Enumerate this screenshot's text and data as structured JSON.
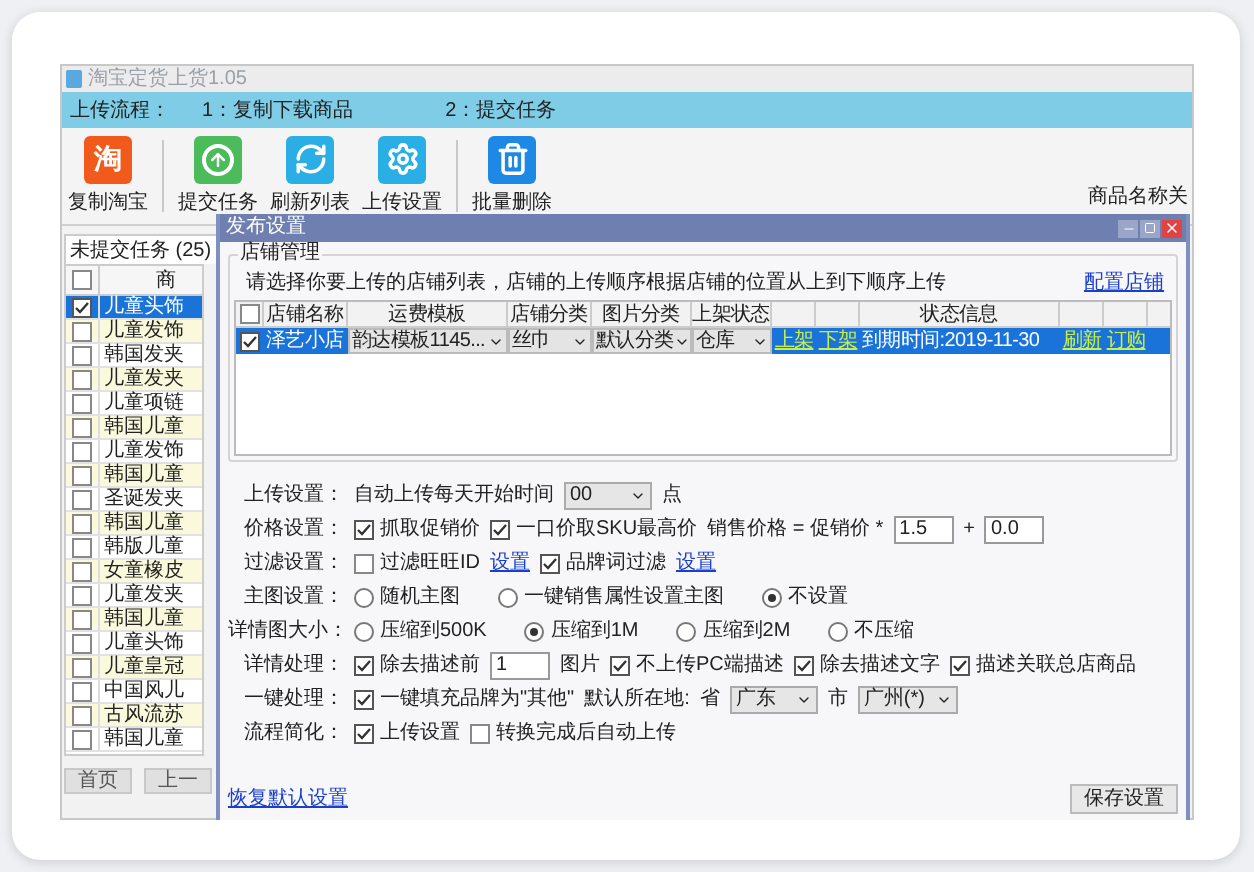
{
  "window": {
    "title": "淘宝定货上货1.05"
  },
  "flow_bar": {
    "label": "上传流程：",
    "steps": [
      "1：复制下载商品",
      "2：提交任务"
    ]
  },
  "toolbar": [
    {
      "kind": "taobao",
      "glyph": "淘",
      "label": "复制淘宝"
    },
    {
      "kind": "upload",
      "label": "提交任务"
    },
    {
      "kind": "refresh",
      "label": "刷新列表"
    },
    {
      "kind": "settings",
      "label": "上传设置"
    },
    {
      "kind": "delete",
      "label": "批量删除"
    }
  ],
  "search_label": "商品名称关",
  "tabs": [
    {
      "label": "未提交任务 (25)",
      "selected": true
    }
  ],
  "task_table": {
    "header_checked": false,
    "columns": [
      "商"
    ],
    "rows": [
      {
        "name": "儿童头饰",
        "checked": true,
        "selected": true
      },
      {
        "name": "儿童发饰",
        "checked": false,
        "selected": false
      },
      {
        "name": "韩国发夹",
        "checked": false,
        "selected": false
      },
      {
        "name": "儿童发夹",
        "checked": false,
        "selected": false
      },
      {
        "name": "儿童项链",
        "checked": false,
        "selected": false
      },
      {
        "name": "韩国儿童",
        "checked": false,
        "selected": false
      },
      {
        "name": "儿童发饰",
        "checked": false,
        "selected": false
      },
      {
        "name": "韩国儿童",
        "checked": false,
        "selected": false
      },
      {
        "name": "圣诞发夹",
        "checked": false,
        "selected": false
      },
      {
        "name": "韩国儿童",
        "checked": false,
        "selected": false
      },
      {
        "name": "韩版儿童",
        "checked": false,
        "selected": false
      },
      {
        "name": "女童橡皮",
        "checked": false,
        "selected": false
      },
      {
        "name": "儿童发夹",
        "checked": false,
        "selected": false
      },
      {
        "name": "韩国儿童",
        "checked": false,
        "selected": false
      },
      {
        "name": "儿童头饰",
        "checked": false,
        "selected": false
      },
      {
        "name": "儿童皇冠",
        "checked": false,
        "selected": false
      },
      {
        "name": "中国风儿",
        "checked": false,
        "selected": false
      },
      {
        "name": "古风流苏",
        "checked": false,
        "selected": false
      },
      {
        "name": "韩国儿童",
        "checked": false,
        "selected": false
      }
    ]
  },
  "pager": [
    "首页",
    "上一"
  ],
  "dialog": {
    "title": "发布设置",
    "shop_group": {
      "title": "店铺管理",
      "hint": "请选择你要上传的店铺列表，店铺的上传顺序根据店铺的位置从上到下顺序上传",
      "config_link": "配置店铺",
      "columns": [
        {
          "kind": "check",
          "checked": false
        },
        {
          "kind": "text",
          "label": "店铺名称"
        },
        {
          "kind": "text",
          "label": "运费模板"
        },
        {
          "kind": "text",
          "label": "店铺分类"
        },
        {
          "kind": "text",
          "label": "图片分类"
        },
        {
          "kind": "text",
          "label": "上架状态"
        },
        {
          "kind": "blank"
        },
        {
          "kind": "blank"
        },
        {
          "kind": "text",
          "label": "状态信息"
        },
        {
          "kind": "blank"
        },
        {
          "kind": "blank"
        }
      ],
      "rows": [
        {
          "selected": true,
          "cells": [
            {
              "kind": "check",
              "checked": true
            },
            {
              "kind": "text",
              "text": "泽艺小店"
            },
            {
              "kind": "select",
              "text": "韵达模板1145..."
            },
            {
              "kind": "select",
              "text": "丝巾"
            },
            {
              "kind": "select",
              "text": "默认分类"
            },
            {
              "kind": "select",
              "text": "仓库"
            },
            {
              "kind": "link",
              "text": "上架"
            },
            {
              "kind": "link",
              "text": "下架"
            },
            {
              "kind": "text",
              "text": "到期时间:2019-11-30"
            },
            {
              "kind": "link",
              "text": "刷新"
            },
            {
              "kind": "link",
              "text": "订购"
            }
          ]
        }
      ]
    },
    "settings": [
      {
        "label": "上传设置：",
        "items": [
          {
            "kind": "text",
            "text": "自动上传每天开始时间"
          },
          {
            "kind": "select",
            "value": "00"
          },
          {
            "kind": "text",
            "text": "点"
          }
        ]
      },
      {
        "label": "价格设置：",
        "items": [
          {
            "kind": "check",
            "label": "抓取促销价",
            "checked": true
          },
          {
            "kind": "check",
            "label": "一口价取SKU最高价",
            "checked": true
          },
          {
            "kind": "text",
            "text": "销售价格 = 促销价 *"
          },
          {
            "kind": "input",
            "value": "1.5"
          },
          {
            "kind": "text",
            "text": "+"
          },
          {
            "kind": "input",
            "value": "0.0"
          }
        ]
      },
      {
        "label": "过滤设置：",
        "items": [
          {
            "kind": "check",
            "label": "过滤旺旺ID",
            "checked": false
          },
          {
            "kind": "link",
            "label": "设置"
          },
          {
            "kind": "check",
            "label": "品牌词过滤",
            "checked": true
          },
          {
            "kind": "link",
            "label": "设置"
          }
        ]
      },
      {
        "label": "主图设置：",
        "items": [
          {
            "kind": "radio",
            "label": "随机主图",
            "selected": false
          },
          {
            "kind": "radio",
            "label": "一键销售属性设置主图",
            "selected": false
          },
          {
            "kind": "radio",
            "label": "不设置",
            "selected": true
          }
        ]
      },
      {
        "label": "详情图大小：",
        "items": [
          {
            "kind": "radio",
            "label": "压缩到500K",
            "selected": false
          },
          {
            "kind": "radio",
            "label": "压缩到1M",
            "selected": true
          },
          {
            "kind": "radio",
            "label": "压缩到2M",
            "selected": false
          },
          {
            "kind": "radio",
            "label": "不压缩",
            "selected": false
          }
        ]
      },
      {
        "label": "详情处理：",
        "items": [
          {
            "kind": "check",
            "label": "除去描述前",
            "checked": true
          },
          {
            "kind": "input",
            "value": "1"
          },
          {
            "kind": "text",
            "text": "图片"
          },
          {
            "kind": "check",
            "label": "不上传PC端描述",
            "checked": true
          },
          {
            "kind": "check",
            "label": "除去描述文字",
            "checked": true
          },
          {
            "kind": "check",
            "label": "描述关联总店商品",
            "checked": true
          }
        ]
      },
      {
        "label": "一键处理：",
        "items": [
          {
            "kind": "check",
            "label": "一键填充品牌为\"其他\"",
            "checked": true
          },
          {
            "kind": "text",
            "text": "默认所在地:"
          },
          {
            "kind": "text",
            "text": "省"
          },
          {
            "kind": "select",
            "value": "广东"
          },
          {
            "kind": "text",
            "text": "市"
          },
          {
            "kind": "select",
            "value": "广州(*)"
          }
        ]
      },
      {
        "label": "流程简化：",
        "items": [
          {
            "kind": "check",
            "label": "上传设置",
            "checked": true
          },
          {
            "kind": "check",
            "label": "转换完成后自动上传",
            "checked": false
          }
        ]
      }
    ],
    "reset_link": "恢复默认设置",
    "save_button": "保存设置"
  }
}
